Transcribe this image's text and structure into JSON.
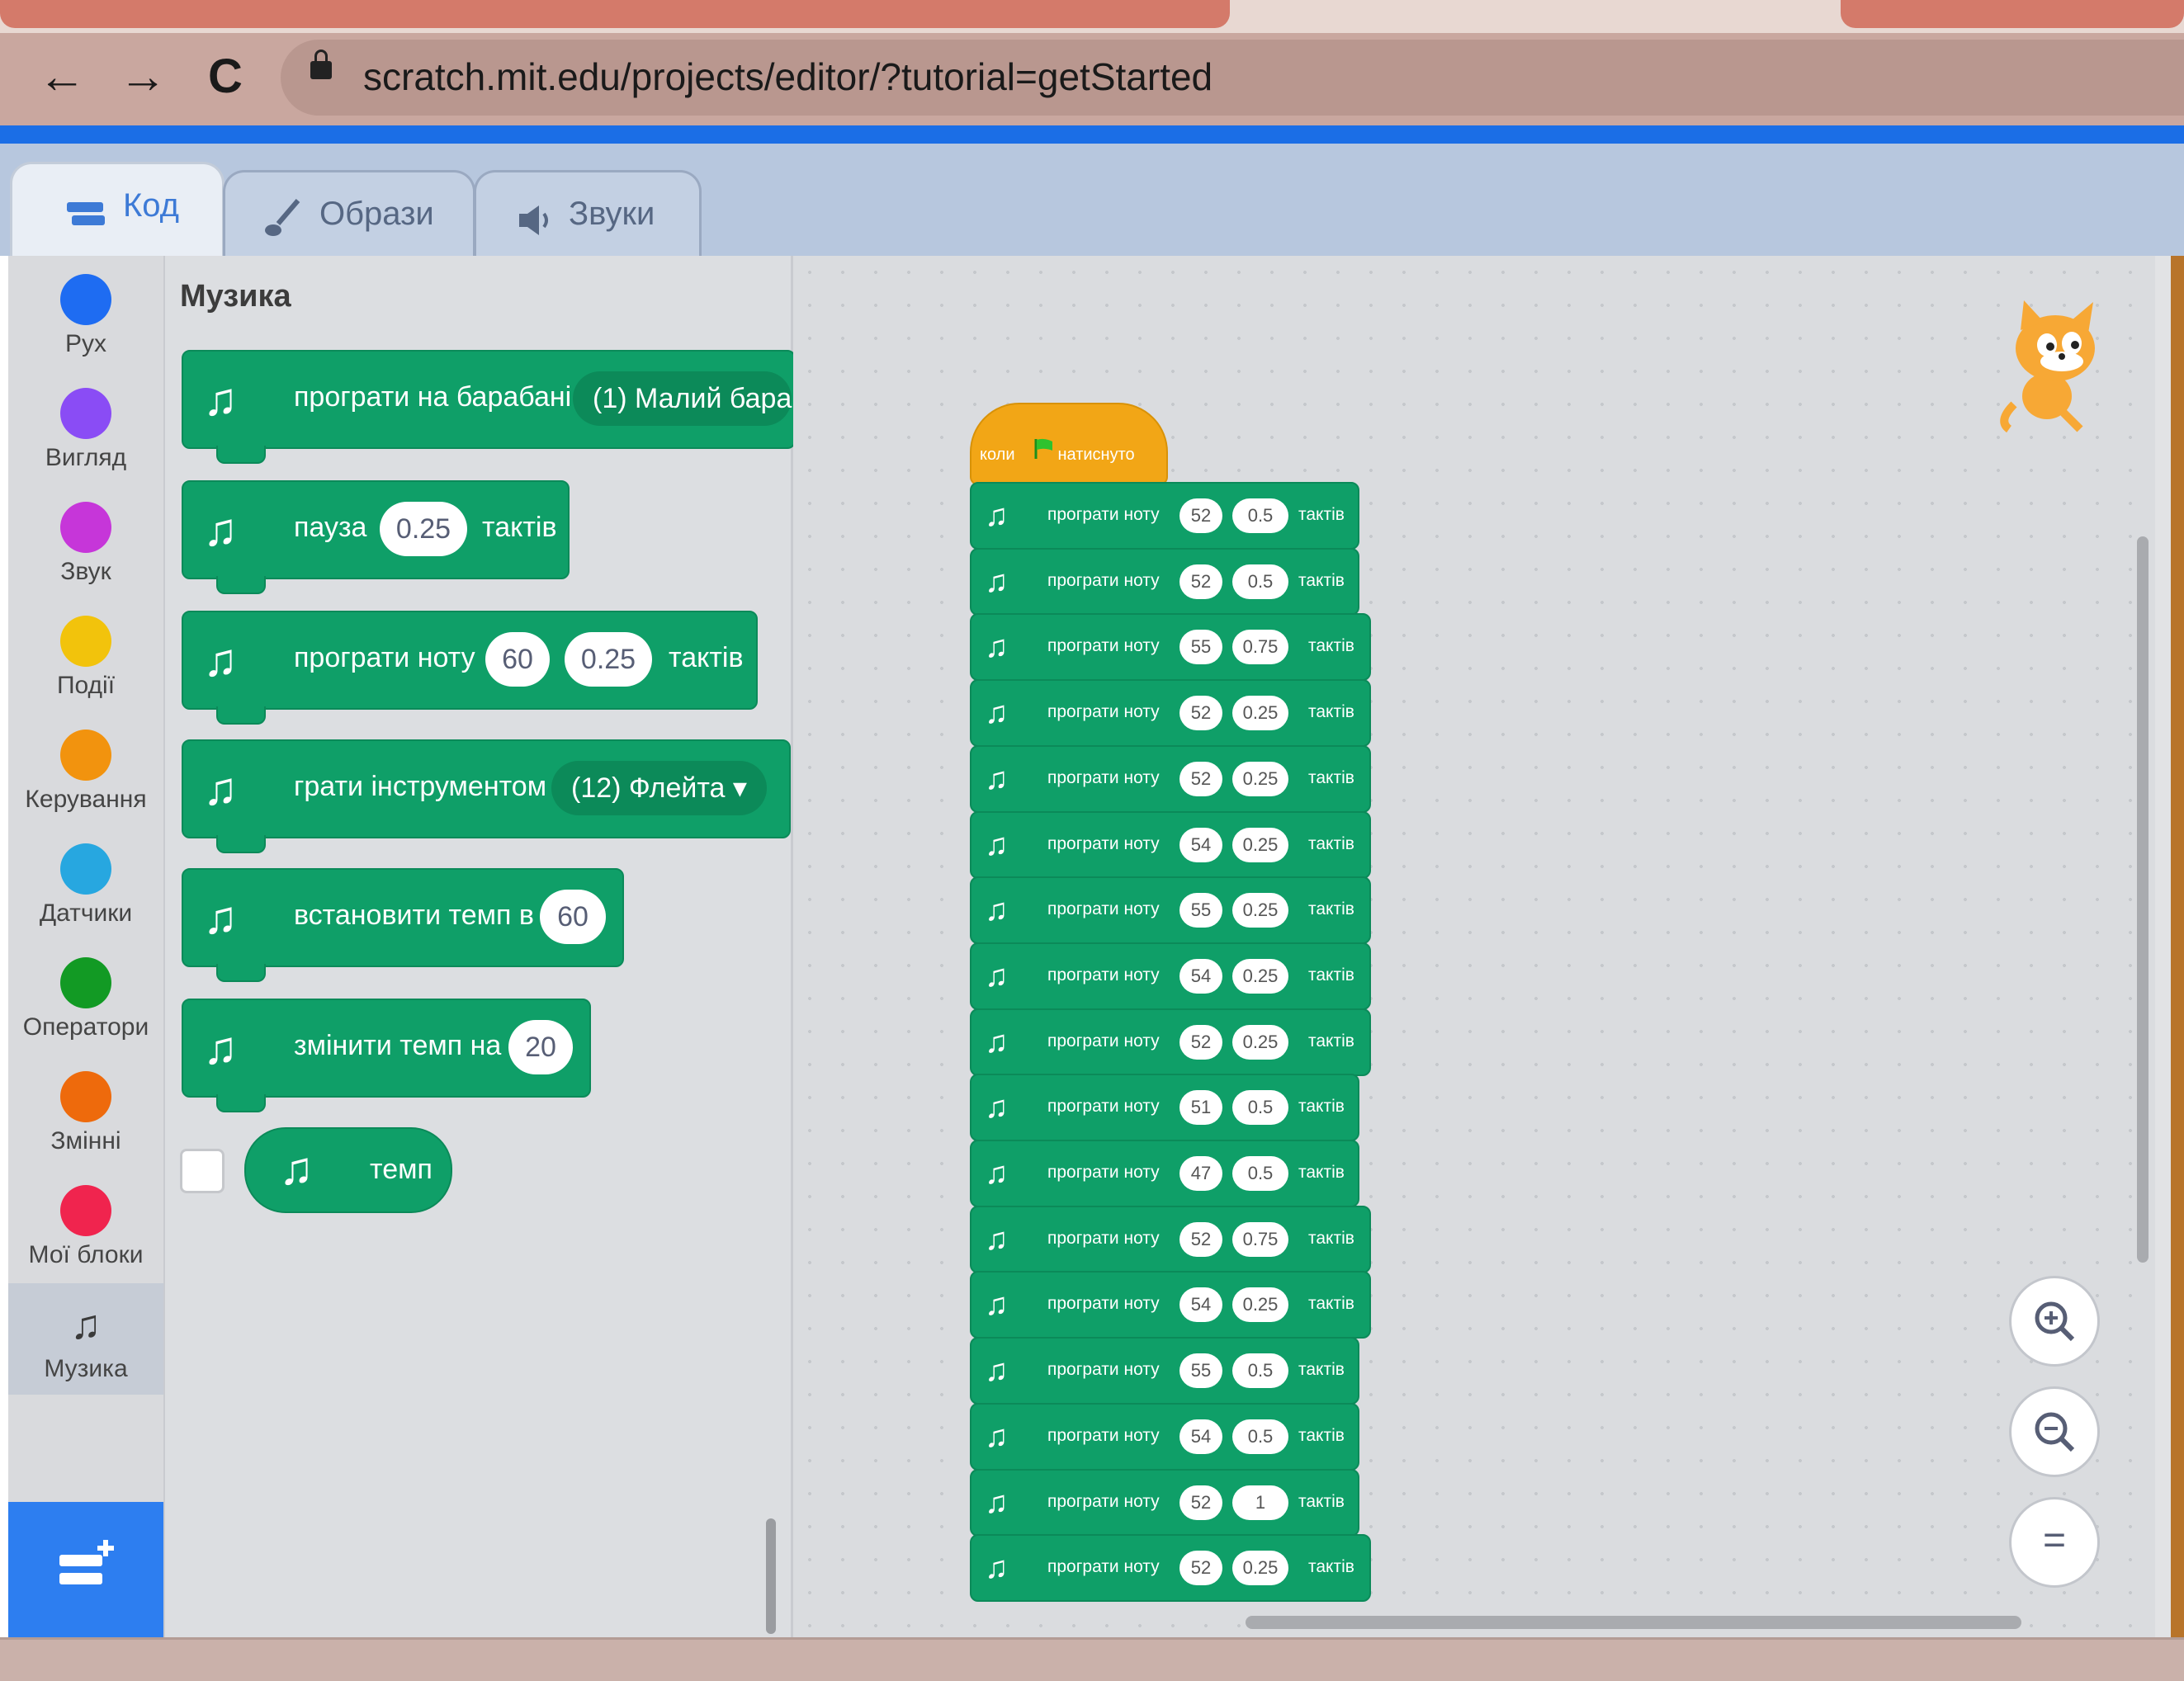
{
  "browser": {
    "url": "scratch.mit.edu/projects/editor/?tutorial=getStarted",
    "back_icon": "←",
    "forward_icon": "→",
    "reload_icon": "C"
  },
  "editor_tabs": [
    {
      "label": "Код",
      "icon": "code-icon",
      "active": true
    },
    {
      "label": "Образи",
      "icon": "brush-icon",
      "active": false
    },
    {
      "label": "Звуки",
      "icon": "speaker-icon",
      "active": false
    }
  ],
  "categories": [
    {
      "label": "Рух",
      "color": "#1e6cf2"
    },
    {
      "label": "Вигляд",
      "color": "#8a4cf5"
    },
    {
      "label": "Звук",
      "color": "#c636d9"
    },
    {
      "label": "Події",
      "color": "#f2c30c"
    },
    {
      "label": "Керування",
      "color": "#f2930e"
    },
    {
      "label": "Датчики",
      "color": "#27a7e0"
    },
    {
      "label": "Оператори",
      "color": "#129a24"
    },
    {
      "label": "Змінні",
      "color": "#ee6a0c"
    },
    {
      "label": "Мої блоки",
      "color": "#f0244e"
    },
    {
      "label": "Музика",
      "icon": "music-notes-icon",
      "selected": true
    }
  ],
  "palette": {
    "title": "Музика",
    "blocks": [
      {
        "text": "програти на барабані",
        "dropdown": "(1) Малий бара"
      },
      {
        "text": "пауза",
        "input": "0.25",
        "suffix": "тактів"
      },
      {
        "text": "програти ноту",
        "input1": "60",
        "input2": "0.25",
        "suffix": "тактів"
      },
      {
        "text": "грати інструментом",
        "dropdown": "(12) Флейта ▾"
      },
      {
        "text": "встановити темп в",
        "input": "60"
      },
      {
        "text": "змінити темп на",
        "input": "20"
      },
      {
        "reporter": "темп"
      }
    ]
  },
  "script": {
    "hat": {
      "text1": "коли",
      "text2": "натиснуто",
      "flag_color": "#2ec22e"
    },
    "block_text": "програти ноту",
    "block_suffix": "тактів",
    "notes": [
      {
        "note": "52",
        "beats": "0.5"
      },
      {
        "note": "52",
        "beats": "0.5"
      },
      {
        "note": "55",
        "beats": "0.75"
      },
      {
        "note": "52",
        "beats": "0.25"
      },
      {
        "note": "52",
        "beats": "0.25"
      },
      {
        "note": "54",
        "beats": "0.25"
      },
      {
        "note": "55",
        "beats": "0.25"
      },
      {
        "note": "54",
        "beats": "0.25"
      },
      {
        "note": "52",
        "beats": "0.25"
      },
      {
        "note": "51",
        "beats": "0.5"
      },
      {
        "note": "47",
        "beats": "0.5"
      },
      {
        "note": "52",
        "beats": "0.75"
      },
      {
        "note": "54",
        "beats": "0.25"
      },
      {
        "note": "55",
        "beats": "0.5"
      },
      {
        "note": "54",
        "beats": "0.5"
      },
      {
        "note": "52",
        "beats": "1"
      },
      {
        "note": "52",
        "beats": "0.25"
      }
    ]
  },
  "zoom": {
    "in_icon": "zoom-in-icon",
    "out_icon": "zoom-out-icon",
    "reset_icon": "zoom-reset-icon",
    "reset_label": "="
  },
  "colors": {
    "music": "#0f9f68",
    "accent": "#2d7ef0",
    "events": "#f2a616"
  }
}
